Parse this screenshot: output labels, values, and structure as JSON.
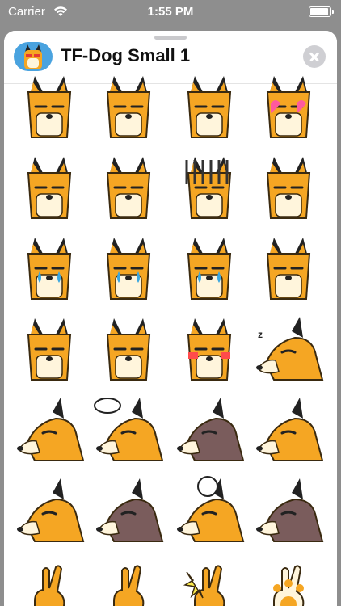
{
  "status_bar": {
    "carrier": "Carrier",
    "time": "1:55 PM",
    "wifi_icon": "wifi-icon",
    "battery_icon": "battery-icon"
  },
  "header": {
    "title": "TF-Dog Small 1",
    "app_icon": "tf-dog-app-icon",
    "close_icon": "close-icon"
  },
  "colors": {
    "dog_orange": "#f5a623",
    "dog_cream": "#fff5dc",
    "ear_black": "#222222",
    "dark_dog": "#7a5c5c",
    "tear_blue": "#3aa7e0",
    "header_blue": "#4aa3df"
  },
  "stickers": [
    {
      "name": "dog-pouting-hands-sticker",
      "kind": "face"
    },
    {
      "name": "dog-scared-sticker",
      "kind": "face"
    },
    {
      "name": "dog-kiss-sticker",
      "kind": "face"
    },
    {
      "name": "dog-heart-eyes-sticker",
      "kind": "face"
    },
    {
      "name": "dog-sparkle-sticker",
      "kind": "face"
    },
    {
      "name": "dog-sweat-surprised-sticker",
      "kind": "face"
    },
    {
      "name": "dog-gloom-lines-sticker",
      "kind": "face"
    },
    {
      "name": "dog-squint-sticker",
      "kind": "face"
    },
    {
      "name": "dog-teary-sticker",
      "kind": "face"
    },
    {
      "name": "dog-crying-sticker",
      "kind": "face"
    },
    {
      "name": "dog-wailing-sticker",
      "kind": "face"
    },
    {
      "name": "dog-sigh-sticker",
      "kind": "face"
    },
    {
      "name": "dog-puff-sticker",
      "kind": "face"
    },
    {
      "name": "dog-fork-spoon-sticker",
      "kind": "face"
    },
    {
      "name": "dog-blush-sticker",
      "kind": "face"
    },
    {
      "name": "dog-sleeping-sticker",
      "kind": "side"
    },
    {
      "name": "dog-side-puff-sticker",
      "kind": "side"
    },
    {
      "name": "dog-thinking-sticker",
      "kind": "side"
    },
    {
      "name": "dog-side-dark-sticker",
      "kind": "side"
    },
    {
      "name": "dog-lying-sticker",
      "kind": "side"
    },
    {
      "name": "dog-lying-down-sticker",
      "kind": "side"
    },
    {
      "name": "dog-lying-dark-sticker",
      "kind": "side"
    },
    {
      "name": "dog-angry-bubble-sticker",
      "kind": "side"
    },
    {
      "name": "dog-lying-dark-2-sticker",
      "kind": "side"
    },
    {
      "name": "dog-peace-hand-sticker",
      "kind": "hand"
    },
    {
      "name": "dog-ok-hand-sticker",
      "kind": "hand"
    },
    {
      "name": "dog-thumbs-up-sticker",
      "kind": "hand"
    },
    {
      "name": "dog-paw-sticker",
      "kind": "hand"
    }
  ]
}
